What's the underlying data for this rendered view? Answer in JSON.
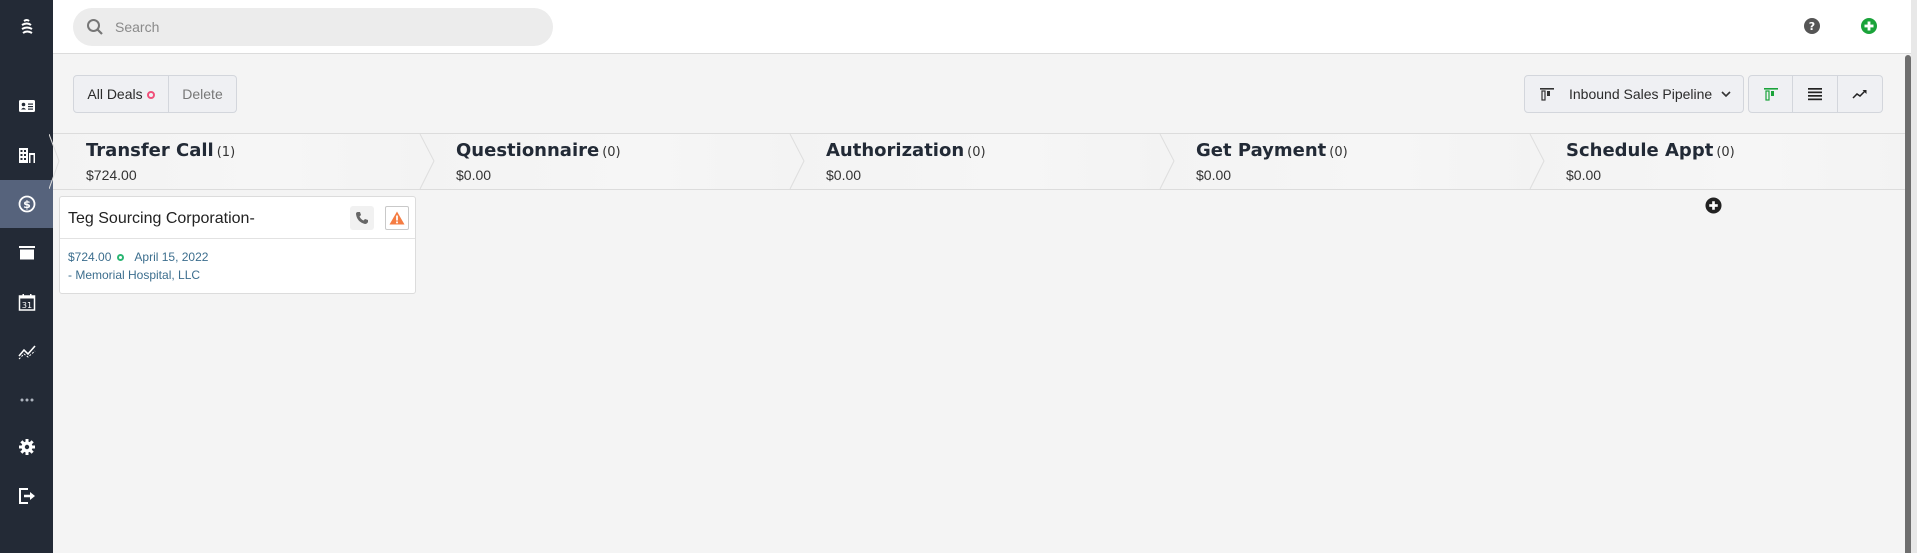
{
  "sidebar": {
    "logo": "app-logo-icon",
    "items": [
      {
        "name": "contacts",
        "icon": "contact-card-icon",
        "active": false
      },
      {
        "name": "companies",
        "icon": "building-icon",
        "active": false
      },
      {
        "name": "deals",
        "icon": "dollar-circle-icon",
        "active": true
      },
      {
        "name": "archive",
        "icon": "archive-box-icon",
        "active": false
      },
      {
        "name": "calendar",
        "icon": "calendar-icon",
        "active": false
      },
      {
        "name": "reports",
        "icon": "trend-line-icon",
        "active": false
      },
      {
        "name": "more",
        "icon": "more-dots-icon",
        "active": false
      },
      {
        "name": "settings",
        "icon": "gear-icon",
        "active": false
      },
      {
        "name": "logout",
        "icon": "logout-icon",
        "active": false
      }
    ]
  },
  "header": {
    "search_placeholder": "Search",
    "search_value": ""
  },
  "toolbar": {
    "all_deals_label": "All Deals",
    "delete_label": "Delete",
    "pipeline_label": "Inbound Sales Pipeline",
    "views": [
      "board-view",
      "list-view",
      "forecast-view"
    ],
    "active_view": "board-view"
  },
  "stages": [
    {
      "title": "Transfer Call",
      "count": "(1)",
      "amount": "$724.00"
    },
    {
      "title": "Questionnaire",
      "count": "(0)",
      "amount": "$0.00"
    },
    {
      "title": "Authorization",
      "count": "(0)",
      "amount": "$0.00"
    },
    {
      "title": "Get Payment",
      "count": "(0)",
      "amount": "$0.00"
    },
    {
      "title": "Schedule Appt",
      "count": "(0)",
      "amount": "$0.00"
    }
  ],
  "deals": [
    {
      "title": "Teg Sourcing Corporation-",
      "amount": "$724.00",
      "date": "April 15, 2022",
      "organization": "- Memorial Hospital, LLC",
      "status_color": "#2bb673"
    }
  ],
  "colors": {
    "sidebar_bg": "#232a36",
    "sidebar_active": "#56637c",
    "accent_green": "#1aa33a",
    "warning_orange": "#f57c42",
    "link_blue": "#3c6e8e",
    "filter_dot": "#f0507a"
  }
}
